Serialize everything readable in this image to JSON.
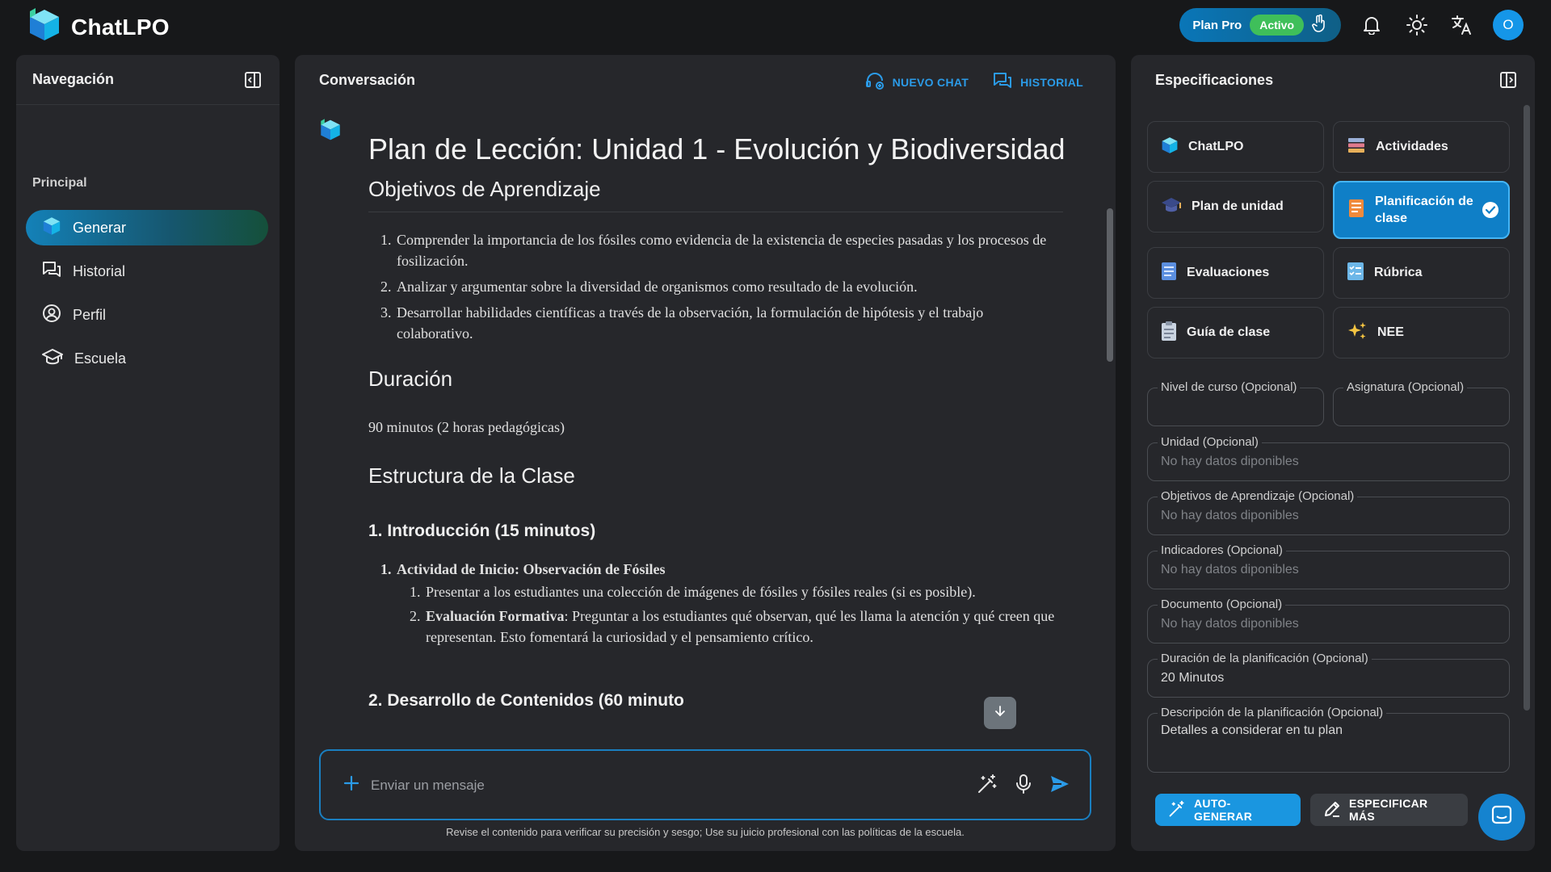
{
  "header": {
    "app_name": "ChatLPO",
    "plan_label": "Plan Pro",
    "plan_status": "Activo",
    "avatar_initial": "O"
  },
  "nav": {
    "title": "Navegación",
    "section": "Principal",
    "items": [
      {
        "label": "Generar",
        "icon": "cube-logo-icon",
        "active": true
      },
      {
        "label": "Historial",
        "icon": "chat-history-icon",
        "active": false
      },
      {
        "label": "Perfil",
        "icon": "user-circle-icon",
        "active": false
      },
      {
        "label": "Escuela",
        "icon": "graduation-cap-icon",
        "active": false
      }
    ]
  },
  "chat": {
    "title": "Conversación",
    "new_chat": "NUEVO CHAT",
    "history": "HISTORIAL",
    "doc": {
      "title": "Plan de Lección: Unidad 1 - Evolución y Biodiversidad",
      "objectives_heading": "Objetivos de Aprendizaje",
      "objectives": [
        {
          "n": "1.",
          "text": "Comprender la importancia de los fósiles como evidencia de la existencia de especies pasadas y los procesos de fosilización."
        },
        {
          "n": "2.",
          "text": "Analizar y argumentar sobre la diversidad de organismos como resultado de la evolución."
        },
        {
          "n": "3.",
          "text": "Desarrollar habilidades científicas a través de la observación, la formulación de hipótesis y el trabajo colaborativo."
        }
      ],
      "duration_heading": "Duración",
      "duration_text": "90 minutos (2 horas pedagógicas)",
      "structure_heading": "Estructura de la Clase",
      "intro_heading": "1. Introducción (15 minutos)",
      "activity_n": "1.",
      "activity_title": "Actividad de Inicio: Observación de Fósiles",
      "sub1_n": "1.",
      "sub1_text": "Presentar a los estudiantes una colección de imágenes de fósiles y fósiles reales (si es posible).",
      "sub2_n": "2.",
      "sub2_bold": "Evaluación Formativa",
      "sub2_text": ": Preguntar a los estudiantes qué observan, qué les llama la atención y qué creen que representan. Esto fomentará la curiosidad y el pensamiento crítico.",
      "dev_heading": "2. Desarrollo de Contenidos (60 minuto"
    },
    "input_placeholder": "Enviar un mensaje",
    "disclaimer": "Revise el contenido para verificar su precisión y sesgo; Use su juicio profesional con las políticas de la escuela."
  },
  "spec": {
    "title": "Especificaciones",
    "cards": [
      {
        "label": "ChatLPO",
        "icon": "cube-logo-icon",
        "selected": false
      },
      {
        "label": "Actividades",
        "icon": "stack-icon",
        "selected": false
      },
      {
        "label": "Plan de unidad",
        "icon": "graduation-cap-icon",
        "selected": false
      },
      {
        "label": "Planificación de clase",
        "icon": "planner-icon",
        "selected": true
      },
      {
        "label": "Evaluaciones",
        "icon": "document-icon",
        "selected": false
      },
      {
        "label": "Rúbrica",
        "icon": "checklist-icon",
        "selected": false
      },
      {
        "label": "Guía de clase",
        "icon": "clipboard-icon",
        "selected": false
      },
      {
        "label": "NEE",
        "icon": "sparkles-icon",
        "selected": false
      }
    ],
    "fields": {
      "nivel": {
        "label": "Nivel de curso (Opcional)",
        "value": ""
      },
      "asignatura": {
        "label": "Asignatura (Opcional)",
        "value": ""
      },
      "unidad": {
        "label": "Unidad (Opcional)",
        "value": "No hay datos diponibles"
      },
      "objetivos": {
        "label": "Objetivos de Aprendizaje (Opcional)",
        "value": "No hay datos diponibles"
      },
      "indicadores": {
        "label": "Indicadores (Opcional)",
        "value": "No hay datos diponibles"
      },
      "documento": {
        "label": "Documento (Opcional)",
        "value": "No hay datos diponibles"
      },
      "duracion": {
        "label": "Duración de la planificación (Opcional)",
        "value": "20 Minutos"
      },
      "descripcion": {
        "label": "Descripción de la planificación (Opcional)",
        "placeholder": "Detalles a considerar en tu plan"
      }
    },
    "auto_button": "AUTO-GENERAR",
    "more_button": "ESPECIFICAR MÁS"
  },
  "colors": {
    "background": "#17181a",
    "panel": "#26272b",
    "accent": "#1a96e0",
    "active_badge": "#3fbf5a"
  }
}
